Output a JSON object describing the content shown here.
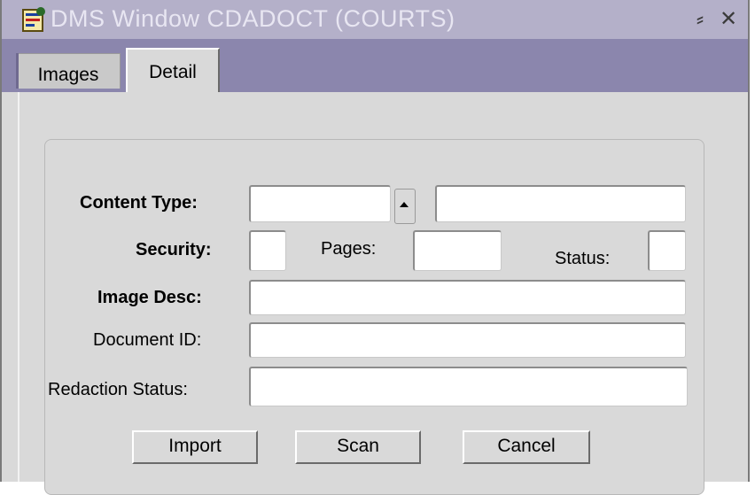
{
  "window": {
    "title": "DMS Window  CDADOCT  (COURTS)",
    "app_icon": "form-app-icon",
    "minimize_icon": "minimize-icon",
    "close_icon": "close-icon",
    "minimize_glyph": "⸗",
    "close_glyph": "✕"
  },
  "tabs": [
    {
      "label": "Images",
      "active": false
    },
    {
      "label": "Detail",
      "active": true
    }
  ],
  "form": {
    "content_type": {
      "label": "Content Type:",
      "value": "",
      "desc_value": ""
    },
    "security": {
      "label": "Security:",
      "value": ""
    },
    "pages": {
      "label": "Pages:",
      "value": ""
    },
    "status": {
      "label": "Status:",
      "value": ""
    },
    "image_desc": {
      "label": "Image Desc:",
      "value": ""
    },
    "document_id": {
      "label": "Document ID:",
      "value": ""
    },
    "redaction_status": {
      "label": "Redaction Status:",
      "value": ""
    }
  },
  "buttons": {
    "import": "Import",
    "scan": "Scan",
    "cancel": "Cancel"
  },
  "colors": {
    "titlebar": "#b4b0c9",
    "tabstrip": "#8b86ad",
    "panel": "#d9d9d9"
  }
}
